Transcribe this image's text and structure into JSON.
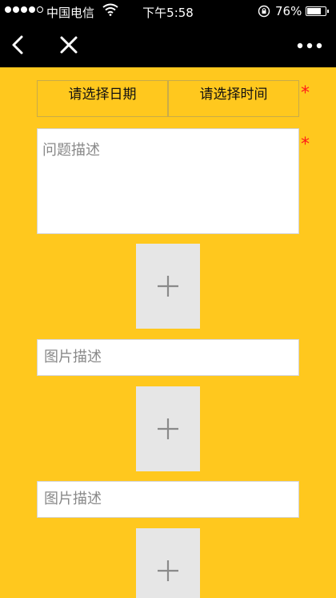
{
  "status_bar": {
    "carrier": "中国电信",
    "time": "下午5:58",
    "battery_percent": "76%",
    "battery_level": 0.76,
    "signal_bars": 4,
    "signal_max": 5
  },
  "nav_bar": {
    "back_icon": "chevron-left-icon",
    "close_icon": "close-icon",
    "more_icon": "more-horizontal-icon"
  },
  "form": {
    "date_select_label": "请选择日期",
    "time_select_label": "请选择时间",
    "required_mark": "*",
    "problem_placeholder": "问题描述",
    "image_add_icon": "plus-icon",
    "image_description_placeholder": "图片描述"
  },
  "colors": {
    "background": "#FFC81E",
    "bar": "#000000",
    "required": "#FF1A1A",
    "image_tile": "#E6E6E6"
  }
}
